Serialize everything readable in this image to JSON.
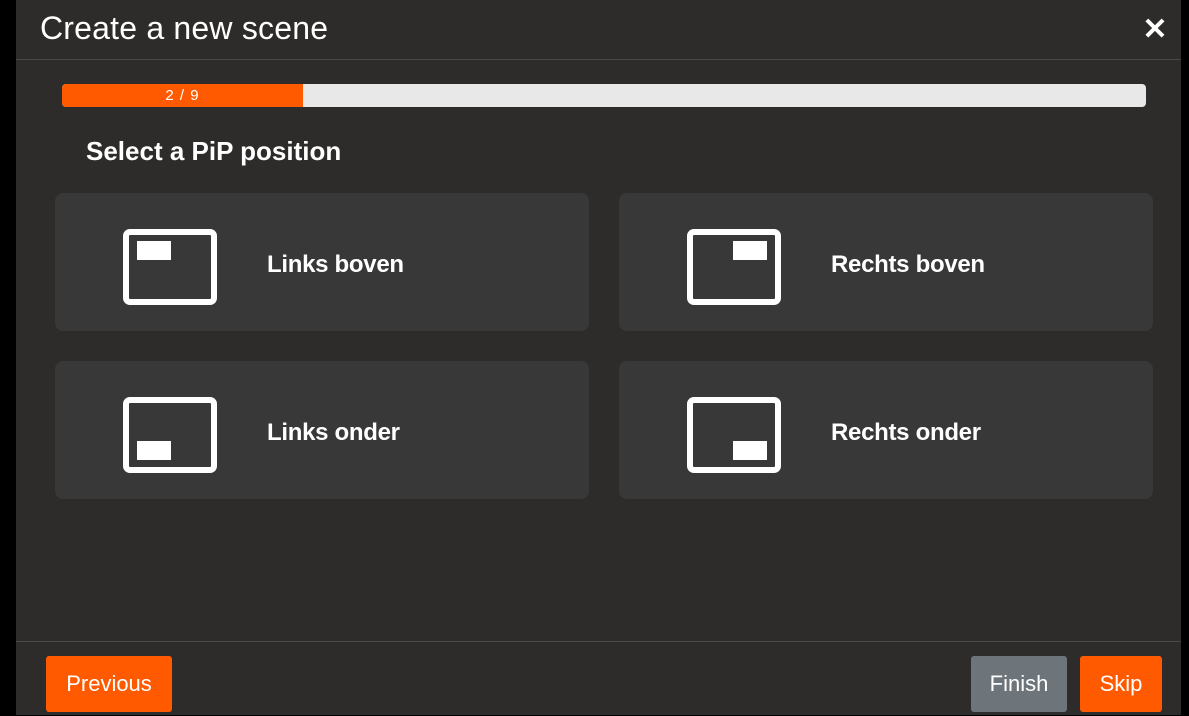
{
  "dialog": {
    "title": "Create a new scene",
    "close_icon": "close-icon"
  },
  "progress": {
    "label": "2 / 9",
    "current": 2,
    "total": 9
  },
  "section": {
    "title": "Select a PiP position"
  },
  "options": [
    {
      "label": "Links boven",
      "icon": "pip-top-left-icon"
    },
    {
      "label": "Rechts boven",
      "icon": "pip-top-right-icon"
    },
    {
      "label": "Links onder",
      "icon": "pip-bottom-left-icon"
    },
    {
      "label": "Rechts onder",
      "icon": "pip-bottom-right-icon"
    }
  ],
  "footer": {
    "previous_label": "Previous",
    "finish_label": "Finish",
    "skip_label": "Skip"
  },
  "colors": {
    "accent": "#ff5a00",
    "background": "#2d2c2a",
    "card": "#383838",
    "finish_button": "#6d747a",
    "progress_track": "#e8e8e8"
  }
}
